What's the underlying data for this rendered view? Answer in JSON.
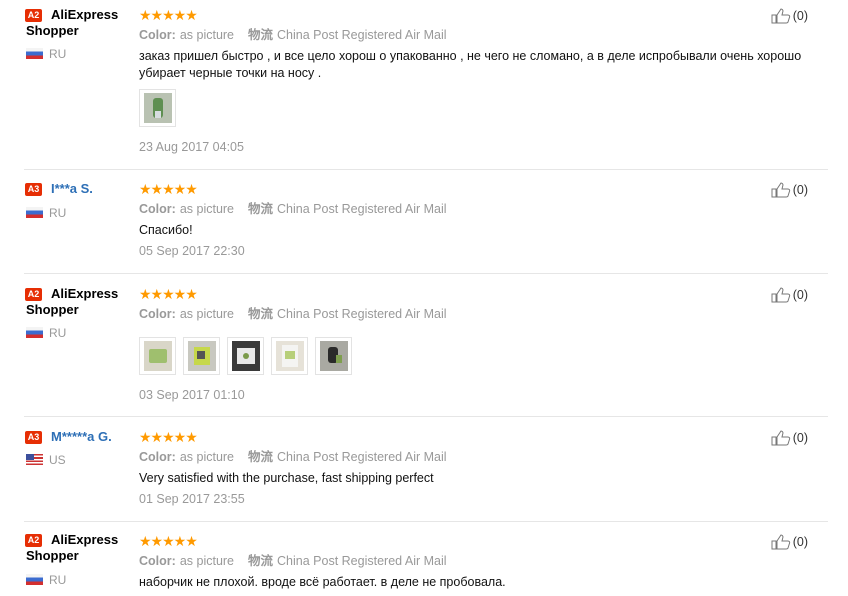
{
  "reviews": [
    {
      "badge": "A2",
      "name_line1": "AliExpress",
      "name_line2": "Shopper",
      "country": "RU",
      "flag": "ru",
      "stars": "★★★★★",
      "color_label": "Color:",
      "color_value": "as picture",
      "ship_label": "物流",
      "ship_value": "China Post Registered Air Mail",
      "text": "заказ пришел быстро , и все цело хорош о упакованно , не чего не сломано, а в деле испробывали очень хорошо убирает черные точки на носу .",
      "photos": 1,
      "date": "23 Aug 2017 04:05",
      "helpful": "(0)"
    },
    {
      "badge": "A3",
      "name_line1": "I***a S.",
      "name_line2": "",
      "country": "RU",
      "flag": "ru",
      "stars": "★★★★★",
      "color_label": "Color:",
      "color_value": "as picture",
      "ship_label": "物流",
      "ship_value": "China Post Registered Air Mail",
      "text": "Спасибо!",
      "photos": 0,
      "date": "05 Sep 2017 22:30",
      "helpful": "(0)"
    },
    {
      "badge": "A2",
      "name_line1": "AliExpress",
      "name_line2": "Shopper",
      "country": "RU",
      "flag": "ru",
      "stars": "★★★★★",
      "color_label": "Color:",
      "color_value": "as picture",
      "ship_label": "物流",
      "ship_value": "China Post Registered Air Mail",
      "text": "",
      "photos": 5,
      "date": "03 Sep 2017 01:10",
      "helpful": "(0)"
    },
    {
      "badge": "A3",
      "name_line1": "M*****a G.",
      "name_line2": "",
      "country": "US",
      "flag": "us",
      "stars": "★★★★★",
      "color_label": "Color:",
      "color_value": "as picture",
      "ship_label": "物流",
      "ship_value": "China Post Registered Air Mail",
      "text": "Very satisfied with the purchase, fast shipping perfect",
      "photos": 0,
      "date": "01 Sep 2017 23:55",
      "helpful": "(0)"
    },
    {
      "badge": "A2",
      "name_line1": "AliExpress",
      "name_line2": "Shopper",
      "country": "RU",
      "flag": "ru",
      "stars": "★★★★★",
      "color_label": "Color:",
      "color_value": "as picture",
      "ship_label": "物流",
      "ship_value": "China Post Registered Air Mail",
      "text": "наборчик не плохой. вроде всё работает. в деле не пробовала.",
      "photos": 0,
      "date": "",
      "helpful": "(0)"
    }
  ],
  "colors": {
    "star": "#ff9a00",
    "badge": "#e62e04",
    "masked_name": "#2d6fb6"
  }
}
